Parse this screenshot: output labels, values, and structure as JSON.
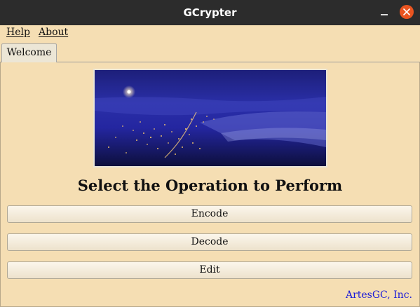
{
  "window": {
    "title": "GCrypter"
  },
  "menu": {
    "help": "Help",
    "about": "About"
  },
  "tabs": [
    {
      "label": "Welcome"
    }
  ],
  "main": {
    "heading": "Select the Operation to Perform",
    "buttons": {
      "encode": "Encode",
      "decode": "Decode",
      "edit": "Edit"
    },
    "footer": "ArtesGC, Inc."
  },
  "colors": {
    "background": "#f5deb3",
    "titlebar": "#2c2c2c",
    "close_button": "#e95420",
    "footer_link": "#1a1ad8"
  }
}
